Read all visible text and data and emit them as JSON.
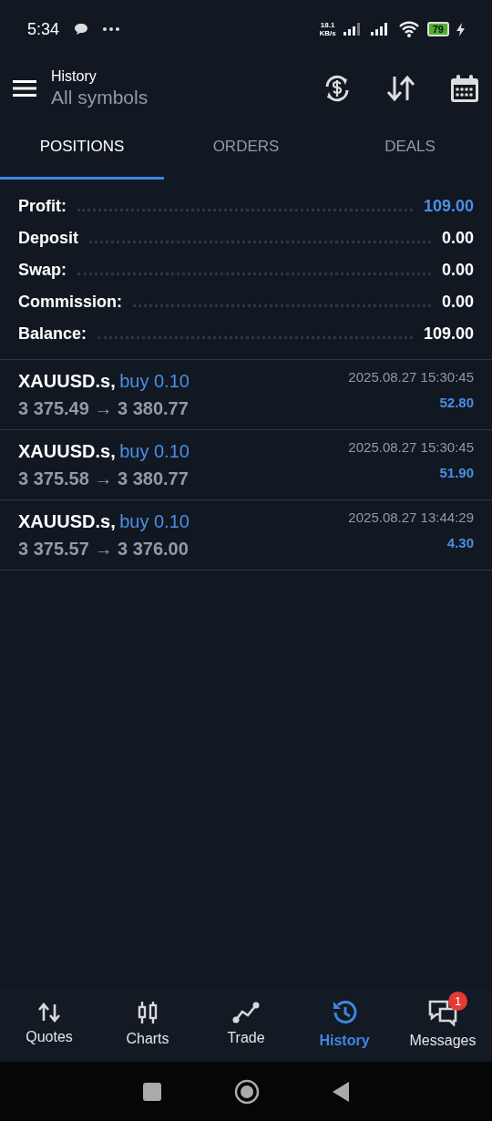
{
  "status_bar": {
    "time": "5:34",
    "speed": "18.1",
    "speed_unit": "KB/s",
    "battery": "79"
  },
  "header": {
    "title": "History",
    "subtitle": "All symbols"
  },
  "tabs": [
    {
      "label": "POSITIONS",
      "selected": true
    },
    {
      "label": "ORDERS",
      "selected": false
    },
    {
      "label": "DEALS",
      "selected": false
    }
  ],
  "summary": [
    {
      "label": "Profit:",
      "value": "109.00",
      "color": "#4a8fe7"
    },
    {
      "label": "Deposit",
      "value": "0.00",
      "color": "#ffffff"
    },
    {
      "label": "Swap:",
      "value": "0.00",
      "color": "#ffffff"
    },
    {
      "label": "Commission:",
      "value": "0.00",
      "color": "#ffffff"
    },
    {
      "label": "Balance:",
      "value": "109.00",
      "color": "#ffffff"
    }
  ],
  "positions": [
    {
      "symbol": "XAUUSD.s,",
      "side": "buy 0.10",
      "prices": "3 375.49 → 3 380.77",
      "time": "2025.08.27 15:30:45",
      "profit": "52.80"
    },
    {
      "symbol": "XAUUSD.s,",
      "side": "buy 0.10",
      "prices": "3 375.58 → 3 380.77",
      "time": "2025.08.27 15:30:45",
      "profit": "51.90"
    },
    {
      "symbol": "XAUUSD.s,",
      "side": "buy 0.10",
      "prices": "3 375.57 → 3 376.00",
      "time": "2025.08.27 13:44:29",
      "profit": "4.30"
    }
  ],
  "bottom_nav": [
    {
      "label": "Quotes",
      "kind": "quotes",
      "selected": false
    },
    {
      "label": "Charts",
      "kind": "charts",
      "selected": false
    },
    {
      "label": "Trade",
      "kind": "trade",
      "selected": false
    },
    {
      "label": "History",
      "kind": "history",
      "selected": true
    },
    {
      "label": "Messages",
      "kind": "messages",
      "selected": false,
      "badge": "1"
    }
  ]
}
